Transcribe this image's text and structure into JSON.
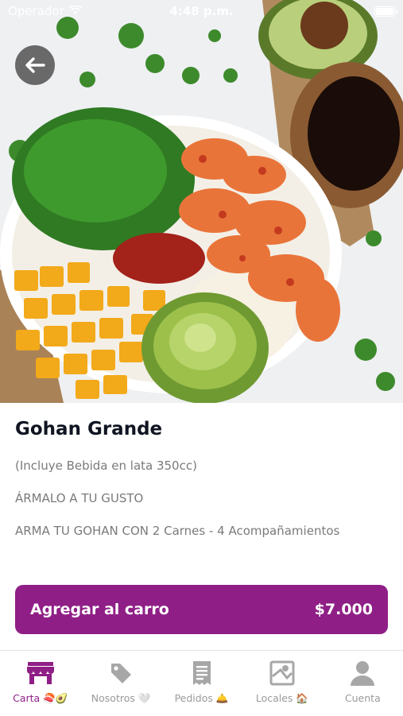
{
  "status_bar": {
    "carrier": "Operador",
    "time": "4:48 p.m."
  },
  "hero": {
    "back_icon": "arrow-left-icon",
    "image_subject": "poke-bowl-photo"
  },
  "product": {
    "title": "Gohan Grande",
    "lines": [
      "(Incluye Bebida en lata 350cc)",
      "ÁRMALO A TU GUSTO",
      "ARMA TU GOHAN CON 2 Carnes  -  4 Acompañamientos"
    ]
  },
  "cart_button": {
    "label": "Agregar al carro",
    "price": "$7.000"
  },
  "tabs": [
    {
      "label": "Carta 🍣🥑",
      "icon": "storefront-icon",
      "active": true
    },
    {
      "label": "Nosotros 🤍",
      "icon": "tag-icon",
      "active": false
    },
    {
      "label": "Pedidos 🛎️",
      "icon": "receipt-icon",
      "active": false
    },
    {
      "label": "Locales 🏠",
      "icon": "map-icon",
      "active": false
    },
    {
      "label": "Cuenta",
      "icon": "user-icon",
      "active": false
    }
  ],
  "colors": {
    "accent": "#8f1f86",
    "inactive": "#9a9a9a",
    "title": "#111522"
  }
}
